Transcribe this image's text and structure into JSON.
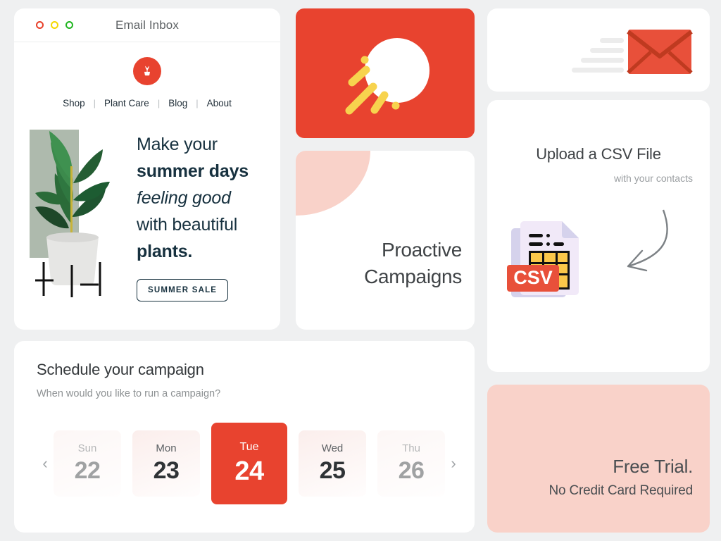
{
  "colors": {
    "accent_red": "#e8432f",
    "pink": "#f9d2c9",
    "page_bg": "#eff0f1",
    "navy": "#17313f",
    "yellow": "#f7d34e"
  },
  "browser": {
    "title": "Email Inbox",
    "traffic_lights": [
      {
        "name": "close-dot",
        "color": "#e8402a"
      },
      {
        "name": "minimize-dot",
        "color": "#f5d800"
      },
      {
        "name": "maximize-dot",
        "color": "#1fb51f"
      }
    ],
    "logo_icon": "potted-plant-icon",
    "nav": [
      {
        "label": "Shop"
      },
      {
        "label": "Plant Care"
      },
      {
        "label": "Blog"
      },
      {
        "label": "About"
      }
    ],
    "nav_separator": "|",
    "hero": {
      "image_alt": "rubber-plant-in-pot",
      "headline": {
        "line1": "Make your",
        "line2": "summer days",
        "line3": "feeling good",
        "line4": "with beautiful",
        "line5": "plants."
      },
      "cta_label": "SUMMER SALE"
    }
  },
  "sun_card": {
    "icon": "sun-with-rays-illustration",
    "circle_color": "#ffffff",
    "ray_color": "#f7d34e",
    "background": "#e8432f"
  },
  "campaigns_card": {
    "title_line1": "Proactive",
    "title_line2": "Campaigns",
    "decoration": "pink-quarter-circle"
  },
  "envelope_card": {
    "icon": "sending-envelope-icon",
    "envelope_color": "#e8432f",
    "speed_lines": 4
  },
  "upload_card": {
    "title": "Upload a CSV File",
    "subtitle": "with your contacts",
    "file_icon": "csv-file-icon",
    "file_badge_label": "CSV",
    "arrow_icon": "curved-arrow-icon"
  },
  "free_trial_card": {
    "title": "Free Trial.",
    "subtitle": "No Credit Card Required"
  },
  "schedule_card": {
    "title": "Schedule your campaign",
    "subtitle": "When would you like to run a campaign?",
    "prev_icon": "chevron-left-icon",
    "next_icon": "chevron-right-icon",
    "prev_glyph": "‹",
    "next_glyph": "›",
    "days": [
      {
        "dow": "Sun",
        "num": "22",
        "state": "faded"
      },
      {
        "dow": "Mon",
        "num": "23",
        "state": "normal"
      },
      {
        "dow": "Tue",
        "num": "24",
        "state": "selected"
      },
      {
        "dow": "Wed",
        "num": "25",
        "state": "normal"
      },
      {
        "dow": "Thu",
        "num": "26",
        "state": "faded"
      }
    ]
  }
}
